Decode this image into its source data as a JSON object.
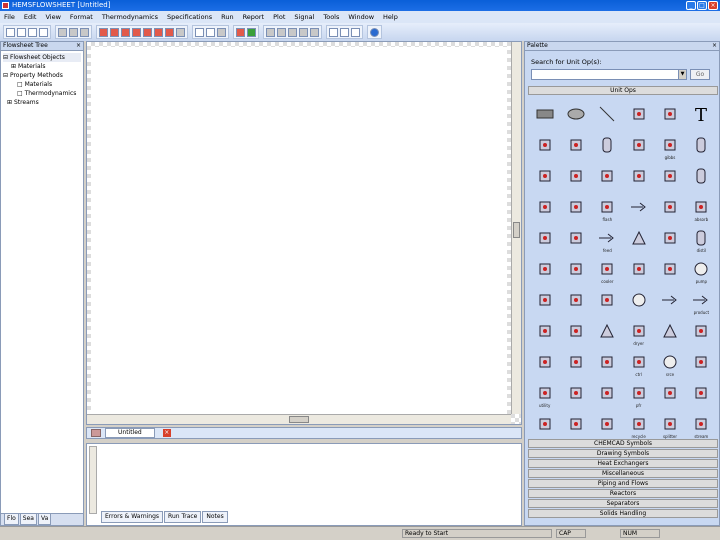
{
  "window": {
    "title": "HEMSFLOWSHEET   [Untitled]",
    "buttons": [
      "_",
      "□",
      "×"
    ]
  },
  "menu": [
    "File",
    "Edit",
    "View",
    "Format",
    "Thermodynamics",
    "Specifications",
    "Run",
    "Report",
    "Plot",
    "Signal",
    "Tools",
    "Window",
    "Help"
  ],
  "leftpanel": {
    "title": "Flowsheet Tree",
    "tree": [
      {
        "label": "Flowsheet Objects",
        "level": 0
      },
      {
        "label": "Materials",
        "level": 1
      },
      {
        "label": "Property Methods",
        "level": 0
      },
      {
        "label": "Materials",
        "level": 2
      },
      {
        "label": "Thermodynamics",
        "level": 2
      },
      {
        "label": "Streams",
        "level": 1
      }
    ],
    "tabs": [
      "Flo",
      "Sea",
      "Va"
    ]
  },
  "document": {
    "tab_label": "Untitled",
    "close": "×"
  },
  "messages": {
    "tabs": [
      "Errors & Warnings",
      "Run Trace",
      "Notes"
    ]
  },
  "palette": {
    "title": "Palette",
    "search_label": "Search for Unit Op(s):",
    "search_value": "",
    "go_label": "Go",
    "top_category": "Unit Ops",
    "symbols": [
      {
        "icon": "rectangle",
        "label": ""
      },
      {
        "icon": "ellipse",
        "label": ""
      },
      {
        "icon": "line",
        "label": ""
      },
      {
        "icon": "bracket",
        "label": ""
      },
      {
        "icon": "rounded-rect",
        "label": ""
      },
      {
        "icon": "text-T",
        "label": ""
      },
      {
        "icon": "exchanger",
        "label": ""
      },
      {
        "icon": "stream",
        "label": ""
      },
      {
        "icon": "column",
        "label": ""
      },
      {
        "icon": "mixer",
        "label": ""
      },
      {
        "icon": "reactor",
        "label": "gibbs"
      },
      {
        "icon": "vessel",
        "label": ""
      },
      {
        "icon": "tank",
        "label": ""
      },
      {
        "icon": "valve",
        "label": ""
      },
      {
        "icon": "pump",
        "label": ""
      },
      {
        "icon": "compressor",
        "label": ""
      },
      {
        "icon": "splitter",
        "label": ""
      },
      {
        "icon": "drum",
        "label": ""
      },
      {
        "icon": "pipe",
        "label": ""
      },
      {
        "icon": "heater",
        "label": ""
      },
      {
        "icon": "separator",
        "label": "flash"
      },
      {
        "icon": "arrow",
        "label": ""
      },
      {
        "icon": "filter",
        "label": ""
      },
      {
        "icon": "tower",
        "label": "absorb"
      },
      {
        "icon": "block",
        "label": ""
      },
      {
        "icon": "cyclone",
        "label": ""
      },
      {
        "icon": "arrow-right",
        "label": "feed"
      },
      {
        "icon": "funnel",
        "label": ""
      },
      {
        "icon": "valve2",
        "label": ""
      },
      {
        "icon": "cylinder",
        "label": "distil"
      },
      {
        "icon": "cross",
        "label": ""
      },
      {
        "icon": "expander",
        "label": ""
      },
      {
        "icon": "coil",
        "label": "cooler"
      },
      {
        "icon": "pump2",
        "label": ""
      },
      {
        "icon": "bars",
        "label": ""
      },
      {
        "icon": "circle",
        "label": "pump"
      },
      {
        "icon": "box",
        "label": ""
      },
      {
        "icon": "turbine",
        "label": ""
      },
      {
        "icon": "diamond",
        "label": ""
      },
      {
        "icon": "sphere",
        "label": ""
      },
      {
        "icon": "long-arrow",
        "label": ""
      },
      {
        "icon": "arrow-out",
        "label": "product"
      },
      {
        "icon": "filter2",
        "label": ""
      },
      {
        "icon": "cell",
        "label": ""
      },
      {
        "icon": "cone",
        "label": ""
      },
      {
        "icon": "stack",
        "label": "dryer"
      },
      {
        "icon": "triangle",
        "label": ""
      },
      {
        "icon": "box2",
        "label": ""
      },
      {
        "icon": "hook",
        "label": ""
      },
      {
        "icon": "exchanger2",
        "label": ""
      },
      {
        "icon": "dot",
        "label": ""
      },
      {
        "icon": "sensor",
        "label": "ctrl"
      },
      {
        "icon": "disk",
        "label": "srce"
      },
      {
        "icon": "probe",
        "label": ""
      },
      {
        "icon": "node",
        "label": "utility"
      },
      {
        "icon": "grid",
        "label": ""
      },
      {
        "icon": "stack2",
        "label": ""
      },
      {
        "icon": "reactor2",
        "label": "pfr"
      },
      {
        "icon": "house",
        "label": ""
      },
      {
        "icon": "node2",
        "label": ""
      },
      {
        "icon": "plug",
        "label": ""
      },
      {
        "icon": "rail",
        "label": ""
      },
      {
        "icon": "spin",
        "label": ""
      },
      {
        "icon": "square",
        "label": "recycle"
      },
      {
        "icon": "square2",
        "label": "splitter"
      },
      {
        "icon": "mixer2",
        "label": "stream"
      }
    ],
    "categories": [
      "CHEMCAD Symbols",
      "Drawing Symbols",
      "Heat Exchangers",
      "Miscellaneous",
      "Piping and Flows",
      "Reactors",
      "Separators",
      "Solids Handling"
    ]
  },
  "status": {
    "cells": [
      "Ready to Start",
      "CAP",
      "NUM"
    ]
  }
}
